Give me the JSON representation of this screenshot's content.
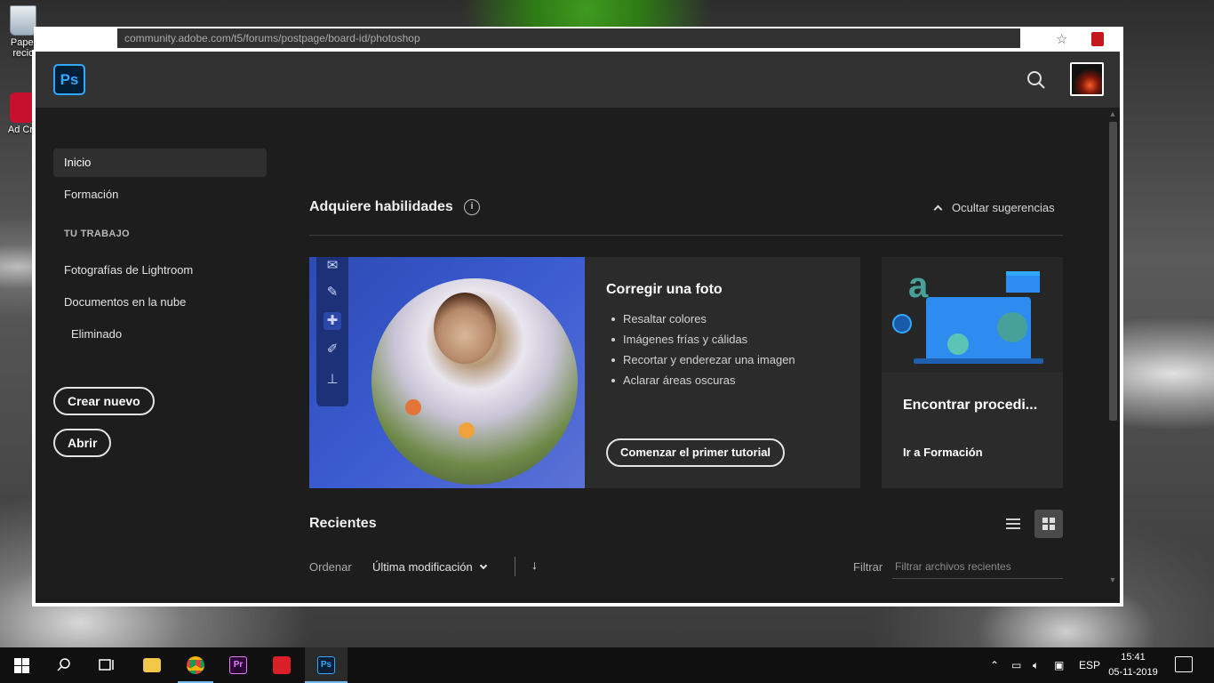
{
  "desktop": {
    "icons": [
      {
        "label": "Papel recic",
        "icon": "recycle-bin-icon"
      },
      {
        "label": "Ad Cre",
        "icon": "adobe-cc-icon"
      }
    ]
  },
  "browser": {
    "url": "community.adobe.com/t5/forums/postpage/board-id/photoshop"
  },
  "app": {
    "logo": "Ps",
    "search_icon": "search-icon",
    "accent": "#31a8ff"
  },
  "sidebar": {
    "items": [
      {
        "label": "Inicio",
        "active": true
      },
      {
        "label": "Formación"
      }
    ],
    "section_label": "TU TRABAJO",
    "work_items": [
      {
        "label": "Fotografías de Lightroom"
      },
      {
        "label": "Documentos en la nube"
      },
      {
        "label": "Eliminado"
      }
    ],
    "create_label": "Crear nuevo",
    "open_label": "Abrir"
  },
  "skills": {
    "title": "Adquiere habilidades",
    "info_icon": "info-icon",
    "hide_label": "Ocultar sugerencias",
    "main_card": {
      "title": "Corregir una foto",
      "bullets": [
        "Resaltar colores",
        "Imágenes frías y cálidas",
        "Recortar y enderezar una imagen",
        "Aclarar áreas oscuras"
      ],
      "button": "Comenzar el primer tutorial"
    },
    "side_card": {
      "title": "Encontrar procedi...",
      "link": "Ir a Formación"
    }
  },
  "recents": {
    "title": "Recientes",
    "view_mode": "grid",
    "sort_label": "Ordenar",
    "sort_value": "Última modificación",
    "filter_label": "Filtrar",
    "filter_placeholder": "Filtrar archivos recientes"
  },
  "taskbar": {
    "apps": [
      {
        "name": "start",
        "icon": "windows-start-icon"
      },
      {
        "name": "search",
        "icon": "search-icon"
      },
      {
        "name": "task-view",
        "icon": "task-view-icon"
      },
      {
        "name": "file-explorer",
        "icon": "folder-icon"
      },
      {
        "name": "chrome",
        "icon": "chrome-icon"
      },
      {
        "name": "premiere",
        "icon": "premiere-icon",
        "label": "Pr"
      },
      {
        "name": "creative-cloud",
        "icon": "creative-cloud-icon"
      },
      {
        "name": "photoshop",
        "icon": "photoshop-icon",
        "label": "Ps",
        "active": true
      }
    ],
    "language": "ESP",
    "time": "15:41",
    "date": "05-11-2019"
  }
}
